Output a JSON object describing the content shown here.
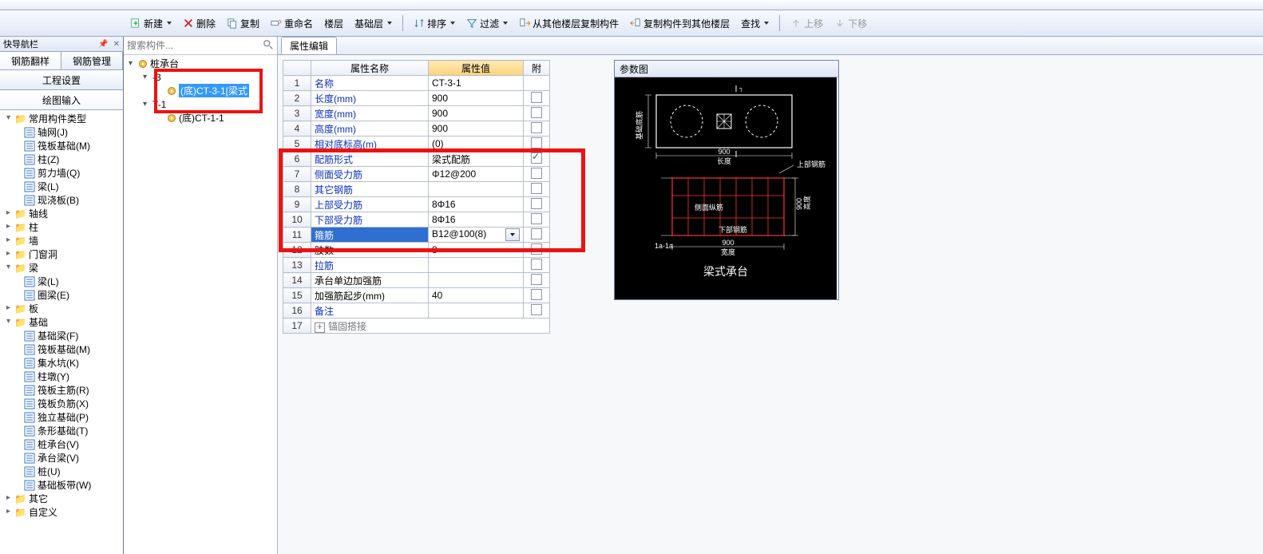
{
  "nav": {
    "panel_title": "快导航栏",
    "tabs": [
      "钢筋翻样",
      "钢筋管理"
    ],
    "bigbtns": [
      "工程设置",
      "绘图输入"
    ],
    "tree": [
      {
        "label": "常用构件类型",
        "folder": true,
        "depth": 0,
        "expanded": true
      },
      {
        "label": "轴网(J)",
        "depth": 1
      },
      {
        "label": "筏板基础(M)",
        "depth": 1
      },
      {
        "label": "柱(Z)",
        "depth": 1
      },
      {
        "label": "剪力墙(Q)",
        "depth": 1
      },
      {
        "label": "梁(L)",
        "depth": 1
      },
      {
        "label": "现浇板(B)",
        "depth": 1
      },
      {
        "label": "轴线",
        "folder": true,
        "depth": 0
      },
      {
        "label": "柱",
        "folder": true,
        "depth": 0
      },
      {
        "label": "墙",
        "folder": true,
        "depth": 0
      },
      {
        "label": "门窗洞",
        "folder": true,
        "depth": 0
      },
      {
        "label": "梁",
        "folder": true,
        "depth": 0,
        "expanded": true
      },
      {
        "label": "梁(L)",
        "depth": 1
      },
      {
        "label": "圈梁(E)",
        "depth": 1
      },
      {
        "label": "板",
        "folder": true,
        "depth": 0
      },
      {
        "label": "基础",
        "folder": true,
        "depth": 0,
        "expanded": true
      },
      {
        "label": "基础梁(F)",
        "depth": 1
      },
      {
        "label": "筏板基础(M)",
        "depth": 1
      },
      {
        "label": "集水坑(K)",
        "depth": 1
      },
      {
        "label": "柱墩(Y)",
        "depth": 1
      },
      {
        "label": "筏板主筋(R)",
        "depth": 1
      },
      {
        "label": "筏板负筋(X)",
        "depth": 1
      },
      {
        "label": "独立基础(P)",
        "depth": 1
      },
      {
        "label": "条形基础(T)",
        "depth": 1
      },
      {
        "label": "桩承台(V)",
        "depth": 1
      },
      {
        "label": "承台梁(V)",
        "depth": 1
      },
      {
        "label": "桩(U)",
        "depth": 1
      },
      {
        "label": "基础板带(W)",
        "depth": 1
      },
      {
        "label": "其它",
        "folder": true,
        "depth": 0
      },
      {
        "label": "自定义",
        "folder": true,
        "depth": 0
      }
    ]
  },
  "search_placeholder": "搜索构件...",
  "comp_tree": [
    {
      "label": "桩承台",
      "depth": 0,
      "expanded": true,
      "gear": true
    },
    {
      "label": "-3",
      "depth": 1,
      "expanded": true
    },
    {
      "label": "(底)CT-3-1[梁式",
      "depth": 2,
      "gear": true,
      "selected": true
    },
    {
      "label": "T-1",
      "depth": 1,
      "expanded": true
    },
    {
      "label": "(底)CT-1-1",
      "depth": 2,
      "gear": true
    }
  ],
  "toolbar": {
    "new": "新建",
    "delete": "删除",
    "copy": "复制",
    "rename": "重命名",
    "floor": "楼层",
    "floor_val": "基础层",
    "sort": "排序",
    "filter": "过滤",
    "copy_from": "从其他楼层复制构件",
    "copy_to": "复制构件到其他楼层",
    "find": "查找",
    "up": "上移",
    "down": "下移"
  },
  "prop": {
    "tab": "属性编辑",
    "headers": {
      "name": "属性名称",
      "value": "属性值",
      "att": "附"
    },
    "rows": [
      {
        "n": "1",
        "name": "名称",
        "val": "CT-3-1",
        "noatt": true
      },
      {
        "n": "2",
        "name": "长度(mm)",
        "val": "900"
      },
      {
        "n": "3",
        "name": "宽度(mm)",
        "val": "900"
      },
      {
        "n": "4",
        "name": "高度(mm)",
        "val": "900"
      },
      {
        "n": "5",
        "name": "相对底标高(m)",
        "val": "(0)"
      },
      {
        "n": "6",
        "name": "配筋形式",
        "val": "梁式配筋",
        "checked": true
      },
      {
        "n": "7",
        "name": "侧面受力筋",
        "val": "Φ12@200"
      },
      {
        "n": "8",
        "name": "其它钢筋",
        "val": ""
      },
      {
        "n": "9",
        "name": "上部受力筋",
        "val": "8Φ16"
      },
      {
        "n": "10",
        "name": "下部受力筋",
        "val": "8Φ16"
      },
      {
        "n": "11",
        "name": "箍筋",
        "val": "B12@100(8)",
        "selected": true,
        "dd": true
      },
      {
        "n": "12",
        "name": "肢数",
        "val": "8",
        "black": true
      },
      {
        "n": "13",
        "name": "拉筋",
        "val": ""
      },
      {
        "n": "14",
        "name": "承台单边加强筋",
        "val": "",
        "black": true
      },
      {
        "n": "15",
        "name": "加强筋起步(mm)",
        "val": "40",
        "black": true
      },
      {
        "n": "16",
        "name": "备注",
        "val": ""
      },
      {
        "n": "17",
        "name": "锚固搭接",
        "val": "",
        "collapsed": true
      }
    ],
    "diagram_title": "参数图",
    "diagram_caption": "梁式承台",
    "diagram_labels": {
      "len": "长度",
      "len_v": "900",
      "wid": "宽度",
      "wid_v": "900",
      "hgt": "高度",
      "hgt_v": "900",
      "top_bar": "上部钢筋",
      "bot_bar": "下部钢筋",
      "side_bar": "侧面纵筋",
      "base_side": "基础底筋",
      "sec": "1a-1a"
    }
  }
}
